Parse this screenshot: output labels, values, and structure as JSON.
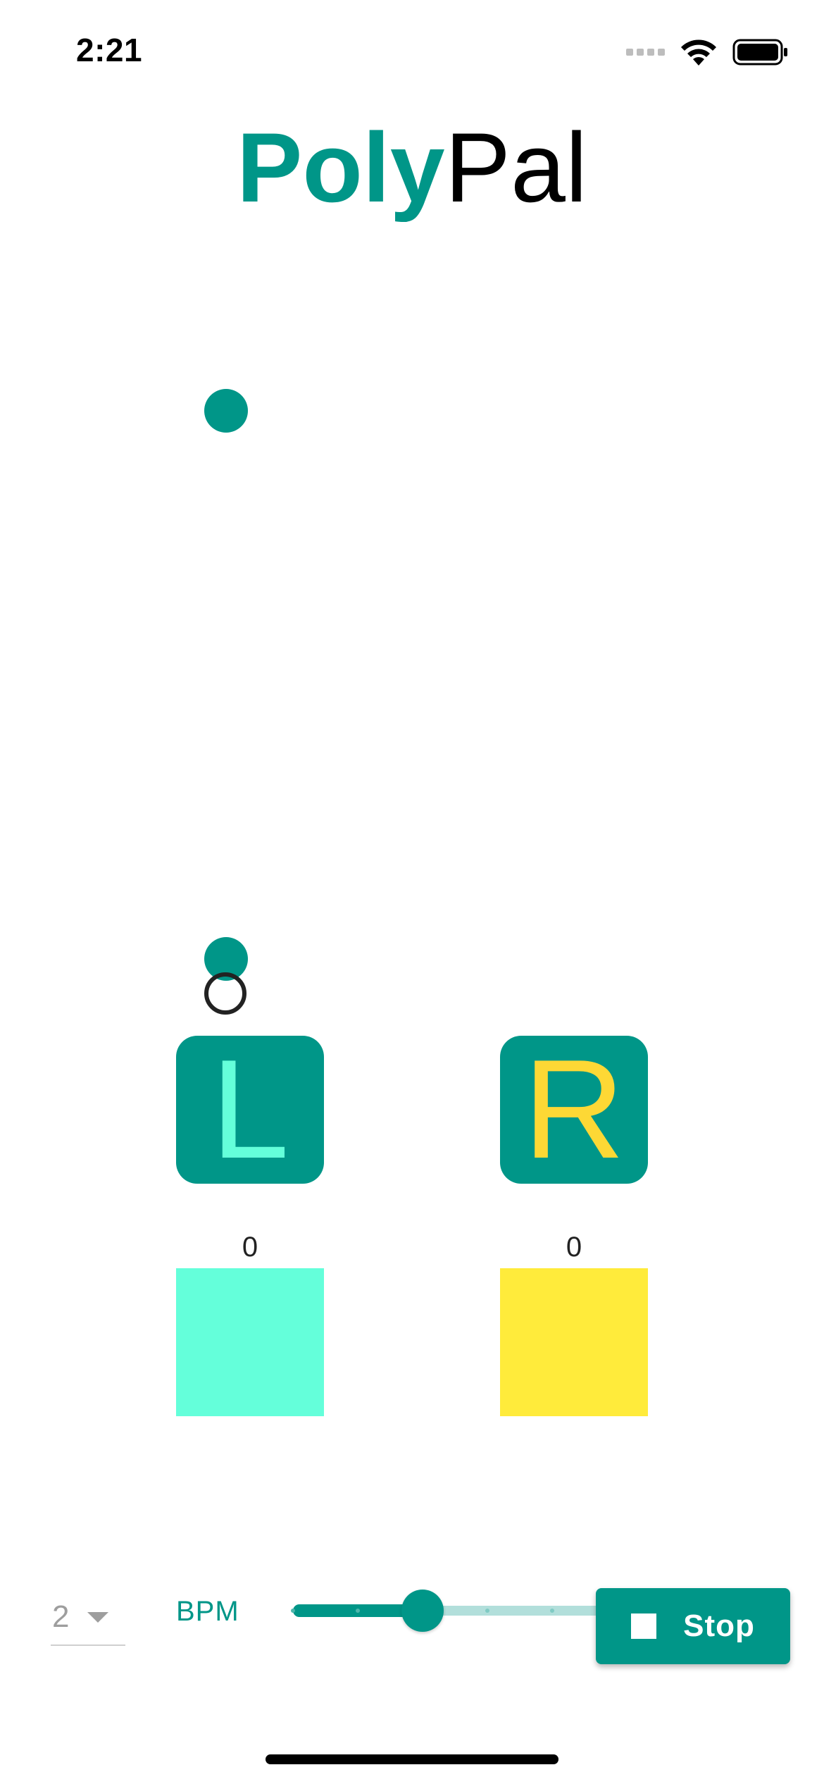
{
  "status_bar": {
    "time": "2:21",
    "icons": [
      "signal-icon",
      "wifi-icon",
      "battery-icon"
    ]
  },
  "title": {
    "bold": "Poly",
    "light": "Pal"
  },
  "colors": {
    "primary": "#009688",
    "left_accent": "#64ffda",
    "right_accent": "#ffeb3b",
    "right_letter": "#fdd835"
  },
  "beat_buttons": {
    "left": "L",
    "right": "R"
  },
  "counts": {
    "left": "0",
    "right": "0"
  },
  "controls": {
    "subdivision": "2",
    "bpm_label": "BPM",
    "slider": {
      "divisions": 5,
      "value_fraction": 0.4
    },
    "stop_label": "Stop"
  }
}
